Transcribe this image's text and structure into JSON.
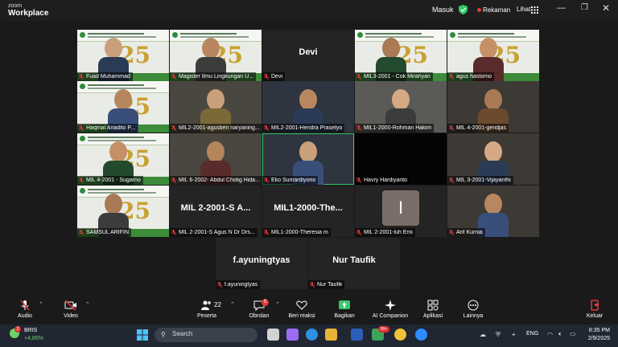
{
  "window": {
    "brand_small": "zoom",
    "brand": "Workplace",
    "masuk_label": "Masuk",
    "record_label": "Rekaman",
    "view_label": "Lihat"
  },
  "tiles": [
    {
      "name": "Fuad Muhammad",
      "style": "banner"
    },
    {
      "name": "Magister Ilmu Lingkungan U...",
      "style": "banner"
    },
    {
      "name": "Devi",
      "style": "name-only",
      "big": "Devi"
    },
    {
      "name": "MIL3-2001 - Cok Mirahyan",
      "style": "banner"
    },
    {
      "name": "agus hastomo",
      "style": "banner"
    },
    {
      "name": "Haqmal Ariadito P...",
      "style": "banner"
    },
    {
      "name": "MIL2-2001-agustien naryaning...",
      "style": "video"
    },
    {
      "name": "MIL2-2001-Hendra Prasetyo",
      "style": "video"
    },
    {
      "name": "MIL1-2000-Rohman Hakim",
      "style": "video"
    },
    {
      "name": "MIL 4-2001-gendjas",
      "style": "video"
    },
    {
      "name": "MIL 4-2001 - Sugarno",
      "style": "banner"
    },
    {
      "name": "MIL 6-2002- Abdul Cholig Hida...",
      "style": "video"
    },
    {
      "name": "Eko Sumardiyono",
      "style": "video"
    },
    {
      "name": "Havry Hardiyanto",
      "style": "black"
    },
    {
      "name": "MIL 3-2001-Vijayanthi",
      "style": "video"
    },
    {
      "name": "SAMSUL ARIFIN",
      "style": "banner"
    },
    {
      "name": "MIL 2-2001-S Agus N Dr Drs...",
      "style": "name-only",
      "big": "MIL 2-2001-S A..."
    },
    {
      "name": "MIL1-2000-Theresia m",
      "style": "name-only",
      "big": "MIL1-2000-The..."
    },
    {
      "name": "MIL 2-2001-luh Emi",
      "style": "letter",
      "big": "I"
    },
    {
      "name": "Arif Kurnia",
      "style": "video"
    },
    {
      "name": "f.ayuningtyas",
      "style": "name-only",
      "big": "f.ayuningtyas"
    },
    {
      "name": "Nur Taufik",
      "style": "name-only",
      "big": "Nur Taufik"
    }
  ],
  "toolbar": {
    "audio": "Audio",
    "video": "Video",
    "participants": "Peserta",
    "participants_count": "22",
    "chat": "Obrolan",
    "chat_badge": "5",
    "reactions": "Beri reaksi",
    "share": "Bagikan",
    "ai": "AI Companion",
    "apps": "Aplikasi",
    "more": "Lainnya",
    "leave": "Keluar"
  },
  "taskbar": {
    "widget_badge": "2",
    "stock_name": "BRIS",
    "stock_change": "+4,86%",
    "search_placeholder": "Search",
    "app_badge": "99+",
    "lang": "ENG",
    "time": "8:35 PM",
    "date": "2/9/2025"
  },
  "colors": {
    "accent_green": "#35c76a",
    "record_red": "#e0383a",
    "leave_red": "#e0383a"
  }
}
